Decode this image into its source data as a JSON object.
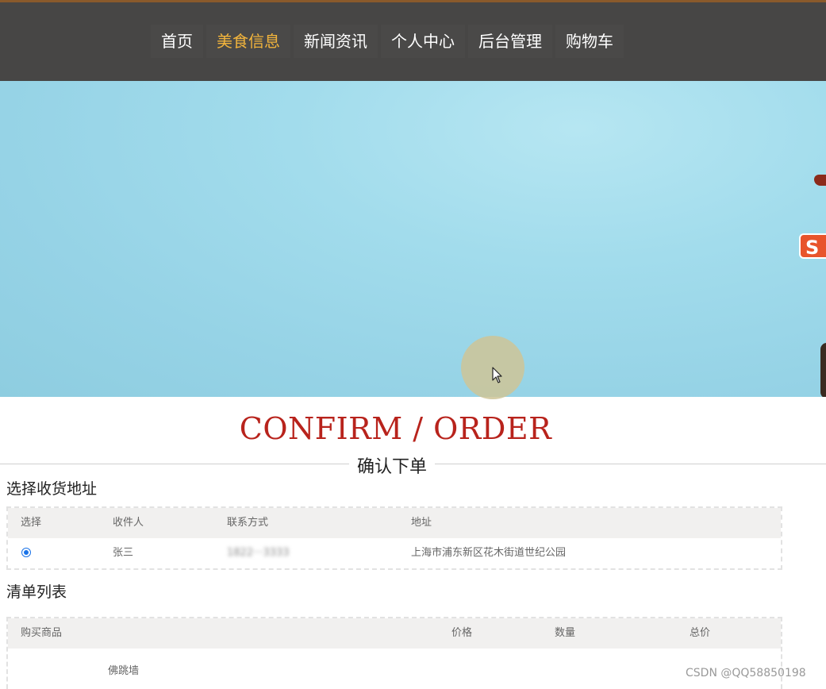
{
  "nav": {
    "items": [
      {
        "label": "首页",
        "active": false
      },
      {
        "label": "美食信息",
        "active": true
      },
      {
        "label": "新闻资讯",
        "active": false
      },
      {
        "label": "个人中心",
        "active": false
      },
      {
        "label": "后台管理",
        "active": false
      },
      {
        "label": "购物车",
        "active": false
      }
    ],
    "active_color": "#f2b43c",
    "bg_color": "#474645"
  },
  "banner": {
    "bg_color": "#9fd9ea",
    "sogou_badge": "S"
  },
  "page": {
    "title_en": "CONFIRM / ORDER",
    "title_cn": "确认下单",
    "title_color": "#b8231c"
  },
  "address_section": {
    "title": "选择收货地址",
    "headers": {
      "select": "选择",
      "recipient": "收件人",
      "contact": "联系方式",
      "address": "地址"
    },
    "rows": [
      {
        "selected": true,
        "recipient": "张三",
        "contact": "1822···3333",
        "address": "上海市浦东新区花木街道世纪公园"
      }
    ]
  },
  "items_section": {
    "title": "清单列表",
    "headers": {
      "product": "购买商品",
      "price": "价格",
      "quantity": "数量",
      "total": "总价"
    },
    "rows": [
      {
        "product": "佛跳墙",
        "price": "",
        "quantity": "",
        "total": ""
      }
    ]
  },
  "watermark": "CSDN @QQ58850198"
}
